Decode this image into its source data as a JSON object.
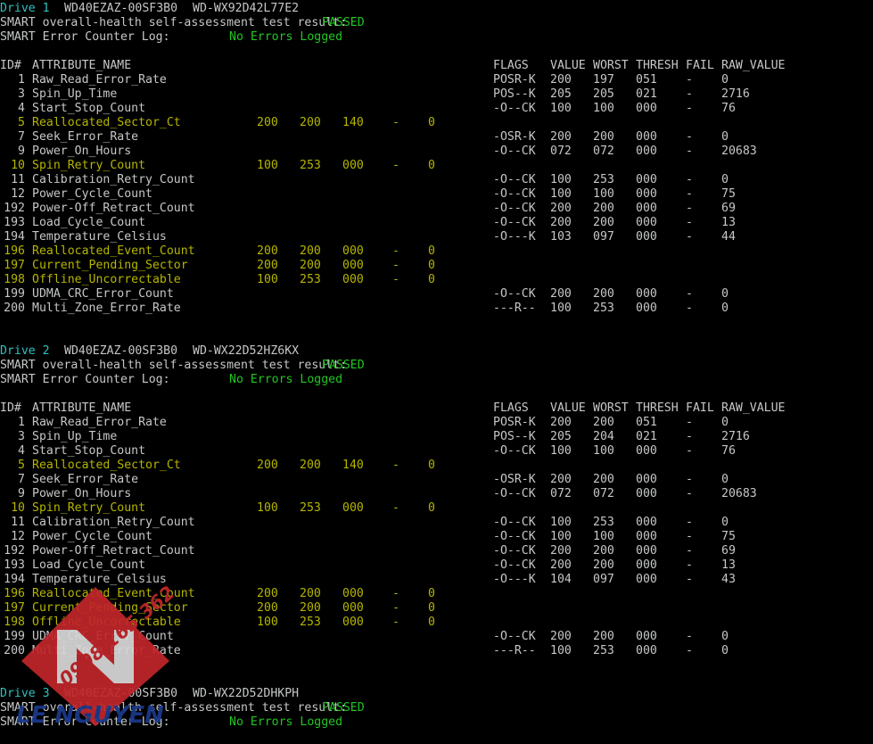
{
  "terminal": {
    "columns_header": {
      "id": "ID#",
      "name": "ATTRIBUTE_NAME",
      "flags": "FLAGS",
      "value": "VALUE",
      "worst": "WORST",
      "thresh": "THRESH",
      "fail": "FAIL",
      "raw_value": "RAW_VALUE"
    },
    "labels": {
      "health_prefix": "SMART overall-health self-assessment test result: ",
      "health_status": "PASSED",
      "error_log_prefix": "SMART Error Counter Log:",
      "error_log_status": "No Errors Logged"
    },
    "colors": {
      "background": "#000000",
      "foreground": "#c5c8c6",
      "drive_label": "#2fc0c0",
      "status_ok": "#22c522",
      "highlight_row": "#b5b500",
      "watermark_red": "#c0262b",
      "watermark_blue": "#1b3a8c",
      "watermark_white": "#d8d8d8"
    },
    "drives": [
      {
        "label": "Drive 1",
        "model": "WD40EZAZ-00SF3B0",
        "serial": "WD-WX92D42L77E2",
        "health": "PASSED",
        "error_log": "No Errors Logged",
        "attributes": [
          {
            "id": "1",
            "name": "Raw_Read_Error_Rate",
            "flags": "POSR-K",
            "value": "200",
            "worst": "197",
            "thresh": "051",
            "fail": "-",
            "raw": "0",
            "highlight": false
          },
          {
            "id": "3",
            "name": "Spin_Up_Time",
            "flags": "POS--K",
            "value": "205",
            "worst": "205",
            "thresh": "021",
            "fail": "-",
            "raw": "2716",
            "highlight": false
          },
          {
            "id": "4",
            "name": "Start_Stop_Count",
            "flags": "-O--CK",
            "value": "100",
            "worst": "100",
            "thresh": "000",
            "fail": "-",
            "raw": "76",
            "highlight": false
          },
          {
            "id": "5",
            "name": "Reallocated_Sector_Ct",
            "flags": "",
            "value": "200",
            "worst": "200",
            "thresh": "140",
            "fail": "-",
            "raw": "0",
            "highlight": true
          },
          {
            "id": "7",
            "name": "Seek_Error_Rate",
            "flags": "-OSR-K",
            "value": "200",
            "worst": "200",
            "thresh": "000",
            "fail": "-",
            "raw": "0",
            "highlight": false
          },
          {
            "id": "9",
            "name": "Power_On_Hours",
            "flags": "-O--CK",
            "value": "072",
            "worst": "072",
            "thresh": "000",
            "fail": "-",
            "raw": "20683",
            "highlight": false
          },
          {
            "id": "10",
            "name": "Spin_Retry_Count",
            "flags": "",
            "value": "100",
            "worst": "253",
            "thresh": "000",
            "fail": "-",
            "raw": "0",
            "highlight": true
          },
          {
            "id": "11",
            "name": "Calibration_Retry_Count",
            "flags": "-O--CK",
            "value": "100",
            "worst": "253",
            "thresh": "000",
            "fail": "-",
            "raw": "0",
            "highlight": false
          },
          {
            "id": "12",
            "name": "Power_Cycle_Count",
            "flags": "-O--CK",
            "value": "100",
            "worst": "100",
            "thresh": "000",
            "fail": "-",
            "raw": "75",
            "highlight": false
          },
          {
            "id": "192",
            "name": "Power-Off_Retract_Count",
            "flags": "-O--CK",
            "value": "200",
            "worst": "200",
            "thresh": "000",
            "fail": "-",
            "raw": "69",
            "highlight": false
          },
          {
            "id": "193",
            "name": "Load_Cycle_Count",
            "flags": "-O--CK",
            "value": "200",
            "worst": "200",
            "thresh": "000",
            "fail": "-",
            "raw": "13",
            "highlight": false
          },
          {
            "id": "194",
            "name": "Temperature_Celsius",
            "flags": "-O---K",
            "value": "103",
            "worst": "097",
            "thresh": "000",
            "fail": "-",
            "raw": "44",
            "highlight": false
          },
          {
            "id": "196",
            "name": "Reallocated_Event_Count",
            "flags": "",
            "value": "200",
            "worst": "200",
            "thresh": "000",
            "fail": "-",
            "raw": "0",
            "highlight": true
          },
          {
            "id": "197",
            "name": "Current_Pending_Sector",
            "flags": "",
            "value": "200",
            "worst": "200",
            "thresh": "000",
            "fail": "-",
            "raw": "0",
            "highlight": true
          },
          {
            "id": "198",
            "name": "Offline_Uncorrectable",
            "flags": "",
            "value": "100",
            "worst": "253",
            "thresh": "000",
            "fail": "-",
            "raw": "0",
            "highlight": true
          },
          {
            "id": "199",
            "name": "UDMA_CRC_Error_Count",
            "flags": "-O--CK",
            "value": "200",
            "worst": "200",
            "thresh": "000",
            "fail": "-",
            "raw": "0",
            "highlight": false
          },
          {
            "id": "200",
            "name": "Multi_Zone_Error_Rate",
            "flags": "---R--",
            "value": "100",
            "worst": "253",
            "thresh": "000",
            "fail": "-",
            "raw": "0",
            "highlight": false
          }
        ]
      },
      {
        "label": "Drive 2",
        "model": "WD40EZAZ-00SF3B0",
        "serial": "WD-WX22D52HZ6KX",
        "health": "PASSED",
        "error_log": "No Errors Logged",
        "attributes": [
          {
            "id": "1",
            "name": "Raw_Read_Error_Rate",
            "flags": "POSR-K",
            "value": "200",
            "worst": "200",
            "thresh": "051",
            "fail": "-",
            "raw": "0",
            "highlight": false
          },
          {
            "id": "3",
            "name": "Spin_Up_Time",
            "flags": "POS--K",
            "value": "205",
            "worst": "204",
            "thresh": "021",
            "fail": "-",
            "raw": "2716",
            "highlight": false
          },
          {
            "id": "4",
            "name": "Start_Stop_Count",
            "flags": "-O--CK",
            "value": "100",
            "worst": "100",
            "thresh": "000",
            "fail": "-",
            "raw": "76",
            "highlight": false
          },
          {
            "id": "5",
            "name": "Reallocated_Sector_Ct",
            "flags": "",
            "value": "200",
            "worst": "200",
            "thresh": "140",
            "fail": "-",
            "raw": "0",
            "highlight": true
          },
          {
            "id": "7",
            "name": "Seek_Error_Rate",
            "flags": "-OSR-K",
            "value": "200",
            "worst": "200",
            "thresh": "000",
            "fail": "-",
            "raw": "0",
            "highlight": false
          },
          {
            "id": "9",
            "name": "Power_On_Hours",
            "flags": "-O--CK",
            "value": "072",
            "worst": "072",
            "thresh": "000",
            "fail": "-",
            "raw": "20683",
            "highlight": false
          },
          {
            "id": "10",
            "name": "Spin_Retry_Count",
            "flags": "",
            "value": "100",
            "worst": "253",
            "thresh": "000",
            "fail": "-",
            "raw": "0",
            "highlight": true
          },
          {
            "id": "11",
            "name": "Calibration_Retry_Count",
            "flags": "-O--CK",
            "value": "100",
            "worst": "253",
            "thresh": "000",
            "fail": "-",
            "raw": "0",
            "highlight": false
          },
          {
            "id": "12",
            "name": "Power_Cycle_Count",
            "flags": "-O--CK",
            "value": "100",
            "worst": "100",
            "thresh": "000",
            "fail": "-",
            "raw": "75",
            "highlight": false
          },
          {
            "id": "192",
            "name": "Power-Off_Retract_Count",
            "flags": "-O--CK",
            "value": "200",
            "worst": "200",
            "thresh": "000",
            "fail": "-",
            "raw": "69",
            "highlight": false
          },
          {
            "id": "193",
            "name": "Load_Cycle_Count",
            "flags": "-O--CK",
            "value": "200",
            "worst": "200",
            "thresh": "000",
            "fail": "-",
            "raw": "13",
            "highlight": false
          },
          {
            "id": "194",
            "name": "Temperature_Celsius",
            "flags": "-O---K",
            "value": "104",
            "worst": "097",
            "thresh": "000",
            "fail": "-",
            "raw": "43",
            "highlight": false
          },
          {
            "id": "196",
            "name": "Reallocated_Event_Count",
            "flags": "",
            "value": "200",
            "worst": "200",
            "thresh": "000",
            "fail": "-",
            "raw": "0",
            "highlight": true
          },
          {
            "id": "197",
            "name": "Current_Pending_Sector",
            "flags": "",
            "value": "200",
            "worst": "200",
            "thresh": "000",
            "fail": "-",
            "raw": "0",
            "highlight": true
          },
          {
            "id": "198",
            "name": "Offline_Uncorrectable",
            "flags": "",
            "value": "100",
            "worst": "253",
            "thresh": "000",
            "fail": "-",
            "raw": "0",
            "highlight": true
          },
          {
            "id": "199",
            "name": "UDMA_CRC_Error_Count",
            "flags": "-O--CK",
            "value": "200",
            "worst": "200",
            "thresh": "000",
            "fail": "-",
            "raw": "0",
            "highlight": false
          },
          {
            "id": "200",
            "name": "Multi_Zone_Error_Rate",
            "flags": "---R--",
            "value": "100",
            "worst": "253",
            "thresh": "000",
            "fail": "-",
            "raw": "0",
            "highlight": false
          }
        ]
      },
      {
        "label": "Drive 3",
        "model": "WD40EZAZ-00SF3B0",
        "serial": "WD-WX22D52DHKPH",
        "health": "PASSED",
        "error_log": "No Errors Logged",
        "attributes": []
      }
    ]
  },
  "watermark": {
    "phone": "0908 165 362",
    "brand": "LE NGUYEN",
    "mark_letter": "N"
  }
}
